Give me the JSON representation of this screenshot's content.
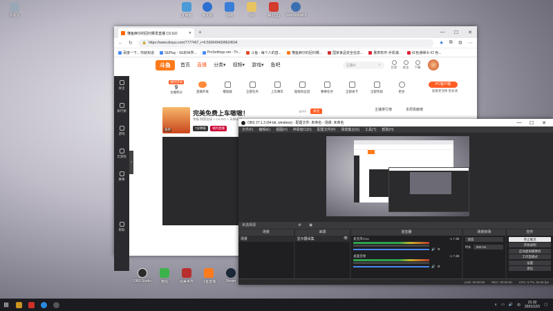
{
  "desktop": {
    "top_icons": [
      {
        "label": "回收站",
        "color": "#9aa7b7"
      },
      {
        "label": "此电脑",
        "color": "#4b9ad8"
      },
      {
        "label": "鲁大师",
        "color": "#2d6fd0"
      },
      {
        "label": "网络",
        "color": "#3a7ed8"
      },
      {
        "label": "cfg",
        "color": "#e8c460"
      },
      {
        "label": "腾讯QQ",
        "color": "#d33b2c"
      },
      {
        "label": "TeamSpeak 3",
        "color": "#3c6fb0"
      }
    ],
    "bottom_icons": [
      {
        "label": "OBS Studio",
        "color": "#2b2b2b"
      },
      {
        "label": "微信",
        "color": "#3cb34a"
      },
      {
        "label": "完美世界",
        "color": "#b82d2d"
      },
      {
        "label": "斗鱼直播",
        "color": "#ff7a1a"
      },
      {
        "label": "Steam",
        "color": "#1b2838"
      }
    ]
  },
  "browser": {
    "tab_title": "懂鱼麻仔的回归赛发直播 CS:GO",
    "new_tab": "+",
    "url": "https://www.douyu.com/7777467_r=0.5926494308624504",
    "bookmarks": [
      "百度一下，你就知道",
      "SEPlay - SE的世界...",
      "ProSettings.net - Th...",
      "斗鱼 - 每个人的直...",
      "懂鱼麻仔的回归赛...",
      "国家食品安全信息...",
      "量表软件-手机端...",
      "红色通缉令-IO 色..."
    ],
    "site": {
      "logo": "斗鱼",
      "nav": [
        "首页",
        "直播",
        "分类▾",
        "视频▾",
        "游戏▾",
        "鱼吧"
      ],
      "nav_active": "直播",
      "search_placeholder": "主播id",
      "tools": [
        "历史",
        "关注",
        "下载"
      ],
      "sidebar": [
        "关注",
        "排行榜",
        "游戏",
        "云游戏",
        "赛事",
        "帮助"
      ],
      "categories_first": {
        "badge": "福利活动",
        "count": "9",
        "label": "主播积分"
      },
      "categories": [
        "直播开发",
        "播放器",
        "全部任务",
        "上车赛车",
        "超级粉丝团",
        "赛事任务",
        "全部关卡",
        "全部奖励",
        "更多"
      ],
      "pc_client": "PC客户端",
      "pc_sub": "观看更流畅 更高清",
      "banner_title": "完美免费上车嗷嗷！",
      "banner_meta": "举报  网游竞技 > CS:GO > 天梯排行",
      "banner_chip1": "7分钟前",
      "banner_chip2": "福利直播",
      "follow_count": "5777",
      "follow_label": "关注",
      "thumb_label": "鱼吧",
      "right_panel_1": "主播排行榜",
      "right_panel_2": "本周贡献榜"
    }
  },
  "obs": {
    "title": "OBS 27.1.3 (64-bit, windows) - 配置文件: 未命名 - 场景: 未命名",
    "menu": [
      "文件(F)",
      "编辑(E)",
      "视图(V)",
      "停靠窗口(D)",
      "配置文件(P)",
      "场景集合(S)",
      "工具(T)",
      "帮助(H)"
    ],
    "no_source": "未选择源",
    "docks": {
      "scenes": {
        "header": "场景",
        "items": [
          "场景"
        ]
      },
      "sources": {
        "header": "来源",
        "items": [
          "显示器采集"
        ]
      },
      "mixer": {
        "header": "混音器",
        "rows": [
          {
            "name": "麦克风/Aux",
            "level": "-1.7 dB"
          },
          {
            "name": "桌面音频",
            "level": "-1.7 dB"
          }
        ]
      },
      "transitions": {
        "header": "场景转场",
        "type": "渐变",
        "duration_label": "时长",
        "duration": "300 ms"
      },
      "controls": {
        "header": "控件",
        "buttons": [
          "停止推流",
          "开始录制",
          "启动虚拟摄像机",
          "工作室模式",
          "设置",
          "退出"
        ],
        "active": "停止推流"
      }
    },
    "status": [
      "LIVE: 00:00:00",
      "REC: 00:00:00",
      "CPU: 0.7%, 60.00 fps"
    ]
  },
  "taskbar": {
    "icons": [
      {
        "name": "start-icon",
        "color": "#ffffff"
      },
      {
        "name": "game-icon",
        "color": "#c9941f"
      },
      {
        "name": "app-icon",
        "color": "#d0302a"
      },
      {
        "name": "edge-icon",
        "color": "#2b8be0"
      },
      {
        "name": "obs-icon",
        "color": "#555555"
      }
    ],
    "time": "21:32",
    "date": "2021/12/1"
  }
}
